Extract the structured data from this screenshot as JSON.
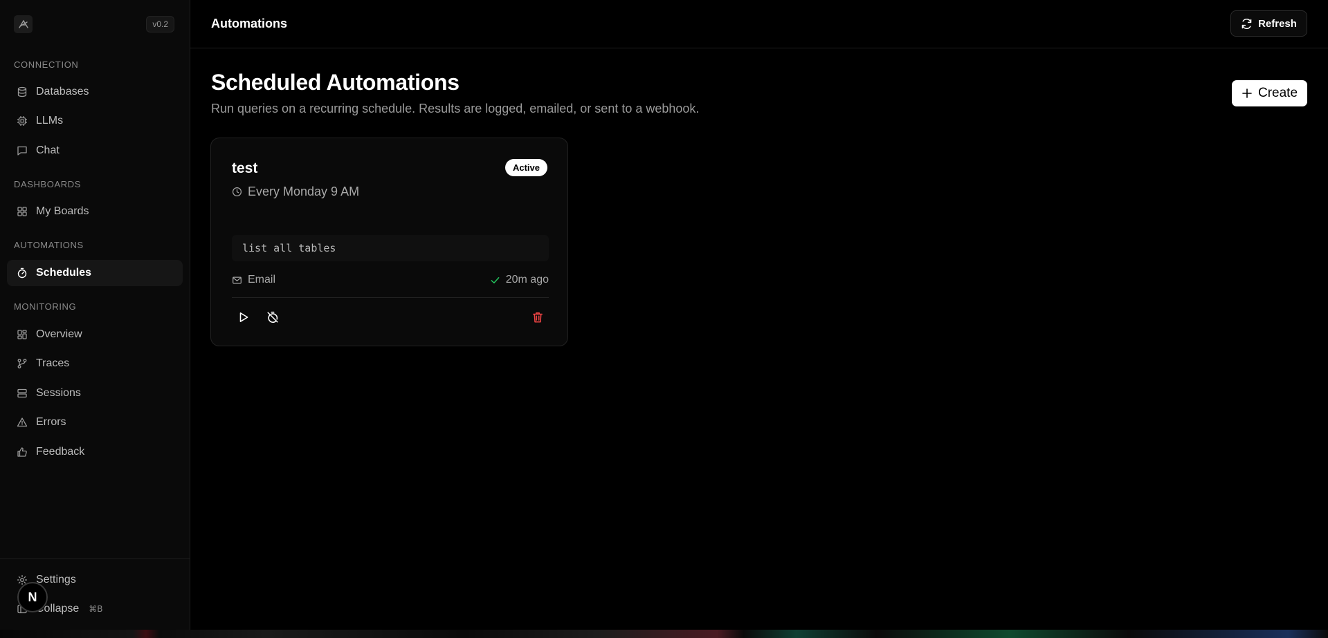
{
  "sidebar": {
    "version": "v0.2",
    "sections": {
      "connection": "CONNECTION",
      "dashboards": "DASHBOARDS",
      "automations": "AUTOMATIONS",
      "monitoring": "MONITORING"
    },
    "items": {
      "databases": "Databases",
      "llms": "LLMs",
      "chat": "Chat",
      "my_boards": "My Boards",
      "schedules": "Schedules",
      "overview": "Overview",
      "traces": "Traces",
      "sessions": "Sessions",
      "errors": "Errors",
      "feedback": "Feedback"
    },
    "footer": {
      "settings": "Settings",
      "collapse": "Collapse",
      "collapse_shortcut": "⌘B"
    },
    "badge": "N"
  },
  "header": {
    "title": "Automations",
    "refresh_label": "Refresh"
  },
  "main": {
    "title": "Scheduled Automations",
    "subtitle": "Run queries on a recurring schedule. Results are logged, emailed, or sent to a webhook.",
    "create_label": "Create",
    "cards": [
      {
        "name": "test",
        "status": "Active",
        "schedule": "Every Monday 9 AM",
        "query": "list all tables",
        "delivery": "Email",
        "last_run": "20m ago"
      }
    ]
  },
  "colors": {
    "background": "#000000",
    "sidebar": "#0a0a0a",
    "success": "#22c55e",
    "danger": "#ef4444"
  }
}
